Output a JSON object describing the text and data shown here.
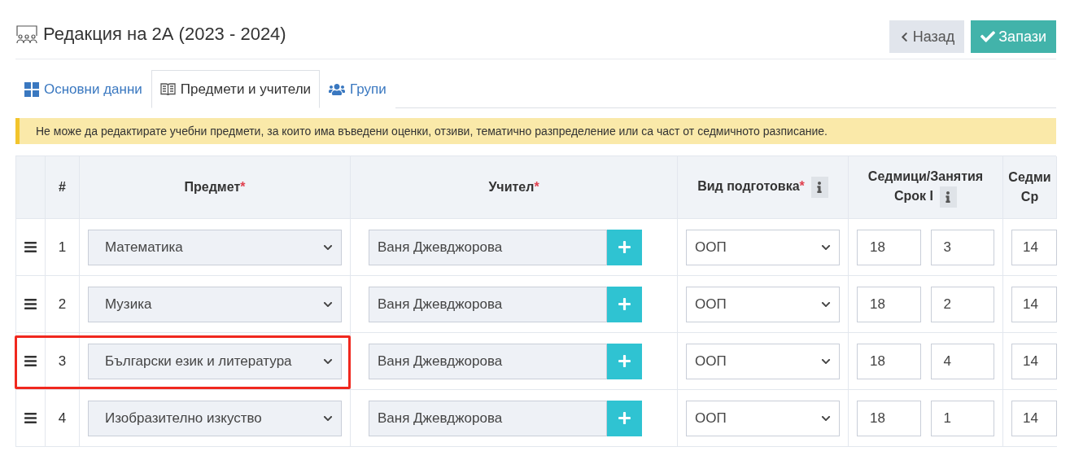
{
  "header": {
    "title": "Редакция на 2А (2023 - 2024)",
    "buttons": [
      {
        "kind": "back",
        "label": "Назад"
      },
      {
        "kind": "save",
        "label": "Запази"
      }
    ]
  },
  "tabs": [
    {
      "kind": "grid",
      "label": "Основни данни",
      "selected": false
    },
    {
      "kind": "book",
      "label": "Предмети и учители",
      "selected": true
    },
    {
      "kind": "users",
      "label": "Групи",
      "selected": false
    }
  ],
  "alert": "Не може да редактирате учебни предмети, за които има въведени оценки, отзиви, тематично разпределение или са част от седмичното разписание.",
  "table": {
    "columns": [
      {
        "kind": "drag"
      },
      {
        "kind": "text",
        "lines": [
          "#"
        ]
      },
      {
        "kind": "text",
        "lines": [
          "Предмет"
        ],
        "required_mark": "*"
      },
      {
        "kind": "text",
        "lines": [
          "Учител"
        ],
        "required_mark": "*"
      },
      {
        "kind": "text",
        "lines": [
          "Вид подготовка"
        ],
        "required_mark": "*",
        "info": true
      },
      {
        "kind": "text",
        "lines": [
          "Седмици/Занятия",
          "Срок I"
        ],
        "info": true
      },
      {
        "kind": "text",
        "lines": [
          "Седми",
          "Ср"
        ]
      }
    ],
    "rows": [
      {
        "number": "1",
        "subject": "Математика",
        "teacher": "Ваня Джевджорова",
        "type": "ООП",
        "weeks": "18",
        "lessons": "3",
        "column_7": "14",
        "highlighted": false
      },
      {
        "number": "2",
        "subject": "Музика",
        "teacher": "Ваня Джевджорова",
        "type": "ООП",
        "weeks": "18",
        "lessons": "2",
        "column_7": "14",
        "highlighted": false
      },
      {
        "number": "3",
        "subject": "Български език и литература",
        "teacher": "Ваня Джевджорова",
        "type": "ООП",
        "weeks": "18",
        "lessons": "4",
        "column_7": "14",
        "highlighted": true
      },
      {
        "number": "4",
        "subject": "Изобразително изкуство",
        "teacher": "Ваня Джевджорова",
        "type": "ООП",
        "weeks": "18",
        "lessons": "1",
        "column_7": "14",
        "highlighted": false
      }
    ]
  }
}
